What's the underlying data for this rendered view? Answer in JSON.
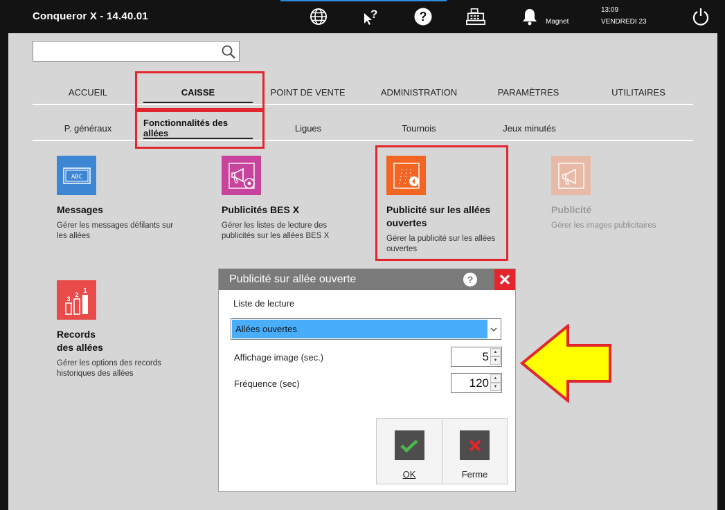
{
  "app": {
    "title": "Conqueror X - 14.40.01"
  },
  "topbar": {
    "icons": [
      "globe-icon",
      "pointer-help-icon",
      "help-icon",
      "cash-register-icon",
      "bell-icon",
      "power-icon"
    ],
    "user": "Magnet",
    "time": "13:09",
    "date": "VENDREDI 23"
  },
  "search": {
    "placeholder": ""
  },
  "tabs": [
    {
      "label": "ACCUEIL"
    },
    {
      "label": "CAISSE"
    },
    {
      "label": "POINT DE VENTE"
    },
    {
      "label": "ADMINISTRATION"
    },
    {
      "label": "PARAMÈTRES"
    },
    {
      "label": "UTILITAIRES"
    }
  ],
  "active_tab": "CAISSE",
  "subtabs": [
    {
      "label": "P. généraux"
    },
    {
      "label": "Fonctionnalités des allées"
    },
    {
      "label": "Ligues"
    },
    {
      "label": "Tournois"
    },
    {
      "label": "Jeux minutés"
    }
  ],
  "active_subtab": "Fonctionnalités des allées",
  "tiles": [
    {
      "title": "Messages",
      "desc": "Gérer les messages défilants sur les allées",
      "icon": "abc-display-icon",
      "color": "#3d86d3",
      "enabled": true
    },
    {
      "title": "Publicités BES X",
      "desc": "Gérer les listes de lecture des publicités sur les allées BES X",
      "icon": "megaphone-gear-icon",
      "color": "#c8449c",
      "enabled": true
    },
    {
      "title": "Publicité sur les allées ouvertes",
      "desc": "Gérer la publicité sur les allées ouvertes",
      "icon": "open-lanes-ad-icon",
      "color": "#f26522",
      "enabled": true
    },
    {
      "title": "Publicité",
      "desc": "Gérer les images publicitaires",
      "icon": "megaphone-icon",
      "color": "#e8b9a6",
      "enabled": false
    },
    {
      "title_line1": "Records",
      "title_line2": "des allées",
      "desc": "Gérer les options des records historiques des allées",
      "icon": "podium-icon",
      "color": "#e94b4b",
      "enabled": true
    }
  ],
  "dialog": {
    "title": "Publicité sur allée ouverte",
    "playlist_label": "Liste de lecture",
    "playlist_value": "Allées ouvertes",
    "display_label": "Affichage image (sec.)",
    "display_value": "5",
    "frequency_label": "Fréquence (sec)",
    "frequency_value": "120",
    "ok_label": "OK",
    "close_label": "Ferme"
  },
  "colors": {
    "highlight_red": "#e3262d",
    "arrow_yellow": "#ffff00",
    "select_blue": "#49aef9"
  }
}
